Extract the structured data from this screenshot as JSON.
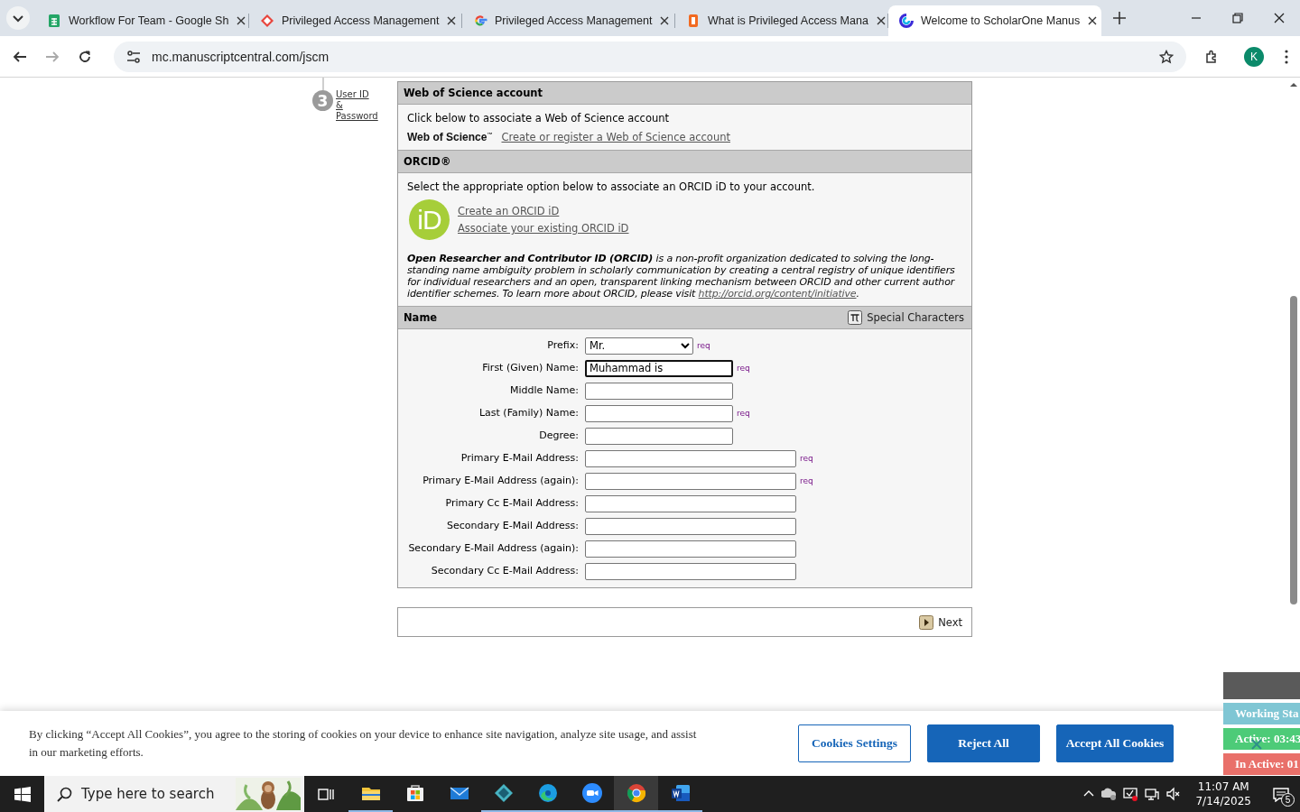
{
  "browser": {
    "tabs": [
      {
        "kind": "sheets",
        "title": "Workflow For Team - Google Sh",
        "selected": false
      },
      {
        "kind": "diamond",
        "title": "Privileged Access Management",
        "selected": false
      },
      {
        "kind": "google",
        "title": "Privileged Access Management",
        "selected": false
      },
      {
        "kind": "book",
        "title": "What is Privileged Access Mana",
        "selected": false
      },
      {
        "kind": "scholarone",
        "title": "Welcome to ScholarOne Manus",
        "selected": true
      }
    ],
    "url": "mc.manuscriptcentral.com/jscm",
    "profile": "K"
  },
  "steps": [
    {
      "number": "3",
      "label": "User ID & Password"
    }
  ],
  "web_of_science": {
    "header": "Web of Science account",
    "text": "Click below to associate a Web of Science account",
    "logo": "Web of Science$^{™}$",
    "link": "Create or register a Web of Science account"
  },
  "orcid": {
    "header": "ORCID®",
    "intro": "Select the appropriate option below to associate an ORCID iD to your account.",
    "logo": "iD",
    "links": [
      "Create an ORCID iD",
      "Associate your existing ORCID iD"
    ],
    "description": "**Open Researcher and Contributor ID (ORCID)** is a non-profit organization dedicated to solving the long-standing name ambiguity problem in scholarly communication by creating a central registry of unique identifiers for individual researchers and an open, transparent linking mechanism between ORCID and other current author identifier schemes. To learn more about ORCID, please visit ",
    "description_link": "http://orcid.org/content/initiative",
    "description_end": "."
  },
  "name_section": {
    "header": "Name",
    "special_characters": "Special Characters",
    "fields": [
      {
        "kind": "select",
        "label": "Prefix:",
        "value": "Mr.",
        "required_mark": "req"
      },
      {
        "kind": "text",
        "label": "First (Given) Name:",
        "value": "Muhammad is",
        "required_mark": "req",
        "wide": false,
        "focused": true
      },
      {
        "kind": "text",
        "label": "Middle Name:",
        "wide": false,
        "focused": false
      },
      {
        "kind": "text",
        "label": "Last (Family) Name:",
        "required_mark": "req",
        "wide": false,
        "focused": false
      },
      {
        "kind": "text",
        "label": "Degree:",
        "wide": false,
        "focused": false
      },
      {
        "kind": "text",
        "label": "Primary E-Mail Address:",
        "required_mark": "req",
        "wide": true,
        "focused": false
      },
      {
        "kind": "text",
        "label": "Primary E-Mail Address (again):",
        "required_mark": "req",
        "wide": true,
        "focused": false
      },
      {
        "kind": "text",
        "label": "Primary Cc E-Mail Address:",
        "wide": true,
        "focused": false
      },
      {
        "kind": "text",
        "label": "Secondary E-Mail Address:",
        "wide": true,
        "focused": false
      },
      {
        "kind": "text",
        "label": "Secondary E-Mail Address (again):",
        "wide": true,
        "focused": false
      },
      {
        "kind": "text",
        "label": "Secondary Cc E-Mail Address:",
        "wide": true,
        "focused": false
      }
    ]
  },
  "next_button": "Next",
  "cookie_banner": {
    "text": "By clicking “Accept All Cookies”, you agree to the storing of cookies on your device to enhance site navigation, analyze site usage, and assist in our marketing efforts.",
    "buttons": [
      {
        "kind": "outline",
        "label": "Cookies Settings"
      },
      {
        "kind": "solid",
        "label": "Reject All"
      },
      {
        "kind": "solid",
        "label": "Accept All Cookies"
      }
    ]
  },
  "status_widget": [
    {
      "label": "Working Sta",
      "color": "#7fc6d4"
    },
    {
      "label": "Active: 03:43",
      "color": "#4dcb78"
    },
    {
      "label": "In Active: 01",
      "color": "#e9706a"
    }
  ],
  "taskbar": {
    "search_placeholder": "Type here to search",
    "apps": [
      {
        "kind": "explorer",
        "running": true,
        "active": false
      },
      {
        "kind": "store",
        "running": false,
        "active": false
      },
      {
        "kind": "mail",
        "running": false,
        "active": false
      },
      {
        "kind": "diamond",
        "running": true,
        "active": false
      },
      {
        "kind": "edge",
        "running": true,
        "active": false
      },
      {
        "kind": "zoom",
        "running": true,
        "active": false
      },
      {
        "kind": "chrome",
        "running": true,
        "active": true
      },
      {
        "kind": "word",
        "running": true,
        "active": false
      }
    ],
    "time": "11:07 AM",
    "date": "7/14/2025",
    "notifications": "5"
  }
}
